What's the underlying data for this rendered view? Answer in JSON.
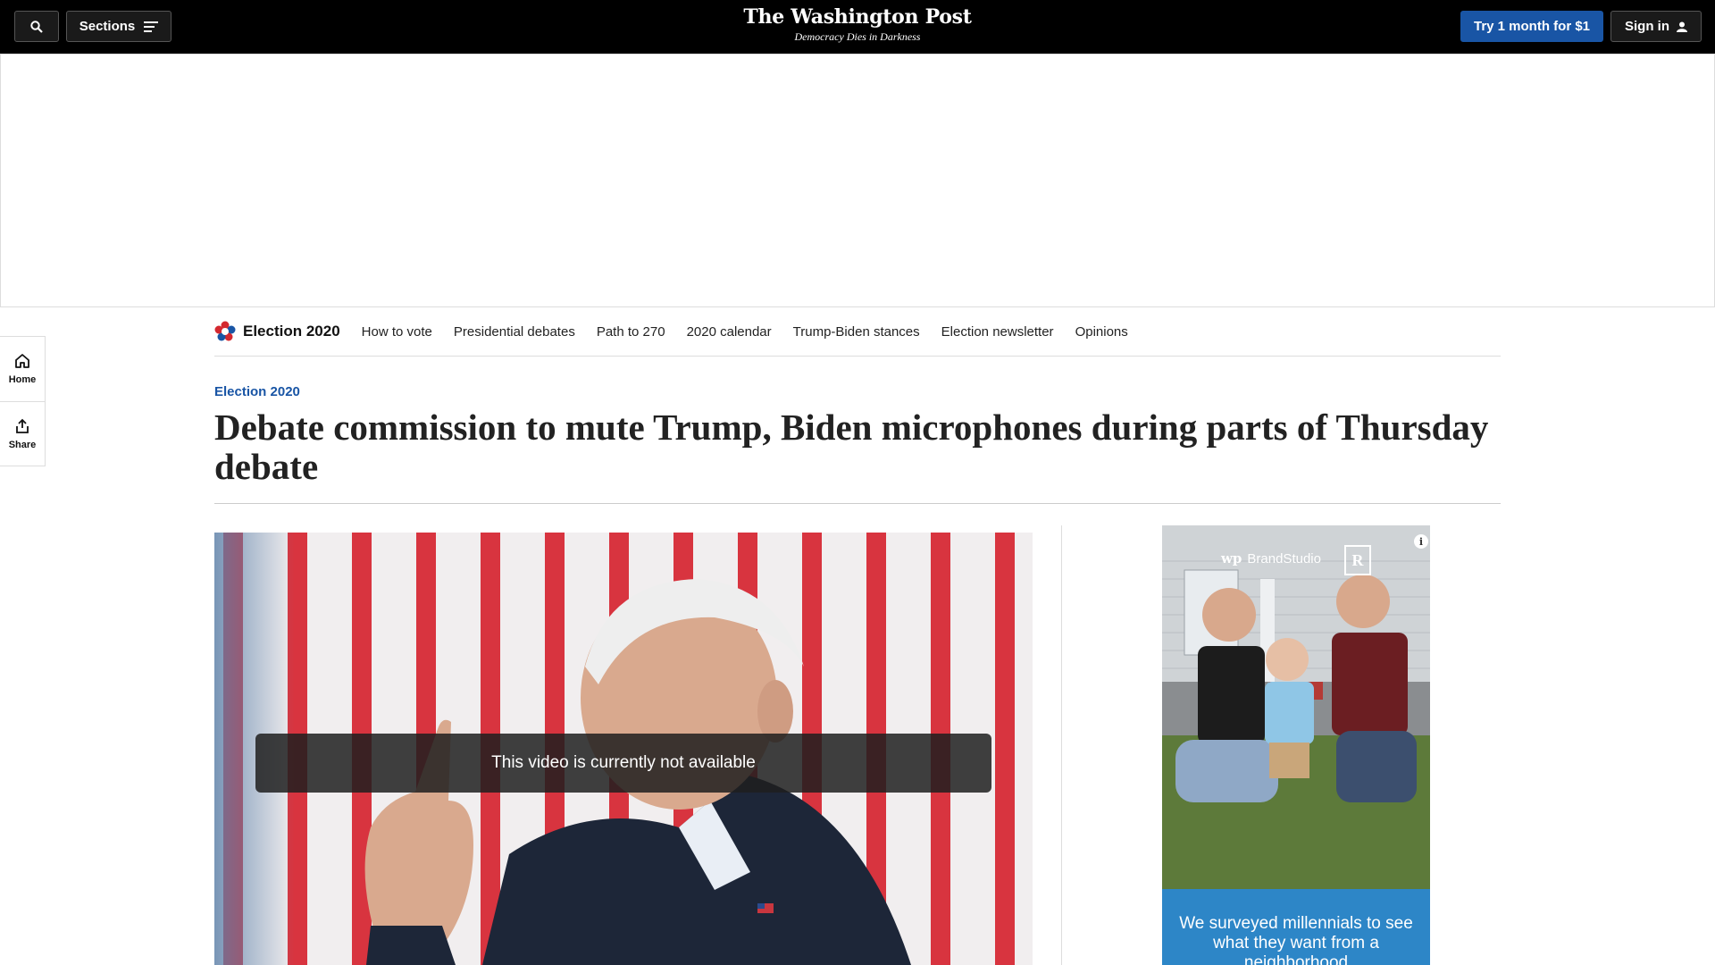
{
  "topbar": {
    "sections_label": "Sections",
    "logo_name": "The Washington Post",
    "logo_tagline": "Democracy Dies in Darkness",
    "try_label": "Try 1 month for $1",
    "signin_label": "Sign in"
  },
  "rail": {
    "home_label": "Home",
    "share_label": "Share"
  },
  "election_nav": {
    "brand": "Election 2020",
    "links": [
      "How to vote",
      "Presidential debates",
      "Path to 270",
      "2020 calendar",
      "Trump-Biden stances",
      "Election newsletter",
      "Opinions"
    ]
  },
  "article": {
    "kicker": "Election 2020",
    "headline": "Debate commission to mute Trump, Biden microphones during parts of Thursday debate",
    "video_message": "This video is currently not available"
  },
  "ad": {
    "brand": "BrandStudio",
    "brand_mark": "wp",
    "realtor_mark": "R",
    "info": "i",
    "text": "We surveyed millennials to see what they want from a neighborhood"
  },
  "colors": {
    "accent": "#1955a5",
    "topbar": "#000000",
    "ad_blue": "#2d86c7"
  }
}
